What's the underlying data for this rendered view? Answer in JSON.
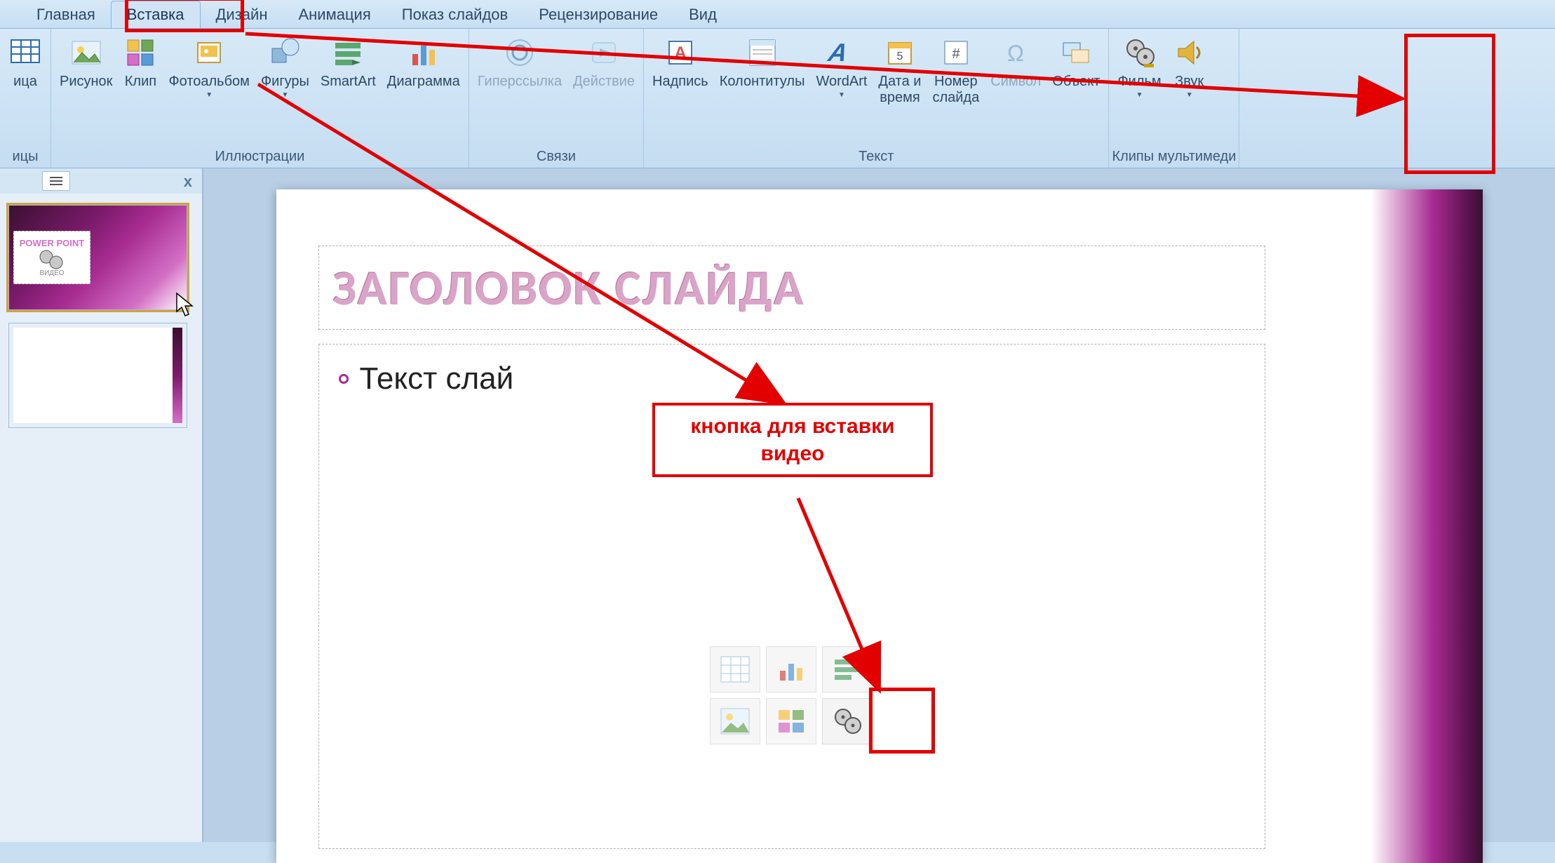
{
  "menu": {
    "tabs": [
      "Главная",
      "Вставка",
      "Дизайн",
      "Анимация",
      "Показ слайдов",
      "Рецензирование",
      "Вид"
    ],
    "active_index": 1
  },
  "ribbon": {
    "groups": [
      {
        "label": "ицы",
        "buttons": [
          {
            "label": "ица",
            "icon": "table",
            "dd": false
          }
        ]
      },
      {
        "label": "Иллюстрации",
        "buttons": [
          {
            "label": "Рисунок",
            "icon": "picture",
            "dd": false
          },
          {
            "label": "Клип",
            "icon": "clip",
            "dd": false
          },
          {
            "label": "Фотоальбом",
            "icon": "album",
            "dd": true
          },
          {
            "label": "Фигуры",
            "icon": "shapes",
            "dd": true
          },
          {
            "label": "SmartArt",
            "icon": "smartart",
            "dd": false
          },
          {
            "label": "Диаграмма",
            "icon": "chart",
            "dd": false
          }
        ]
      },
      {
        "label": "Связи",
        "buttons": [
          {
            "label": "Гиперссылка",
            "icon": "link",
            "dd": false,
            "disabled": true
          },
          {
            "label": "Действие",
            "icon": "action",
            "dd": false,
            "disabled": true
          }
        ]
      },
      {
        "label": "Текст",
        "buttons": [
          {
            "label": "Надпись",
            "icon": "textbox",
            "dd": false
          },
          {
            "label": "Колонтитулы",
            "icon": "headerfooter",
            "dd": false
          },
          {
            "label": "WordArt",
            "icon": "wordart",
            "dd": true
          },
          {
            "label": "Дата и\nвремя",
            "icon": "datetime",
            "dd": false
          },
          {
            "label": "Номер\nслайда",
            "icon": "slidenum",
            "dd": false
          },
          {
            "label": "Символ",
            "icon": "symbol",
            "dd": false,
            "disabled": true
          },
          {
            "label": "Объект",
            "icon": "object",
            "dd": false
          }
        ]
      },
      {
        "label": "Клипы мультимеди",
        "buttons": [
          {
            "label": "Фильм",
            "icon": "movie",
            "dd": true
          },
          {
            "label": "Звук",
            "icon": "sound",
            "dd": true
          }
        ]
      }
    ]
  },
  "slide": {
    "title": "ЗАГОЛОВОК СЛАЙДА",
    "body": "Текст слай"
  },
  "thumb1": {
    "line1": "POWER POINT",
    "line2": "ВИДЕО"
  },
  "annotation": {
    "label": "кнопка для\nвставки видео"
  },
  "panel": {
    "close": "x"
  }
}
